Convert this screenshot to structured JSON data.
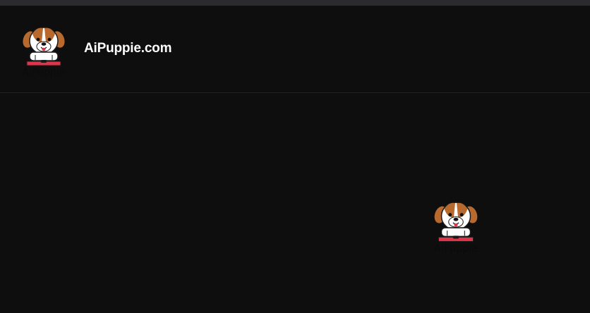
{
  "header": {
    "site_name": "AiPuppie.com",
    "logo_label": "AiPuppie",
    "logo_icon": "puppy-logo-icon"
  },
  "main": {
    "loading_logo_label": "AiPuppie",
    "loading_logo_icon": "puppy-logo-icon"
  },
  "colors": {
    "background": "#0e0e0e",
    "topbar": "#2b2b2d",
    "divider": "#232325",
    "text": "#ffffff",
    "fur_brown": "#b86a2e",
    "collar_red": "#e0344a"
  }
}
